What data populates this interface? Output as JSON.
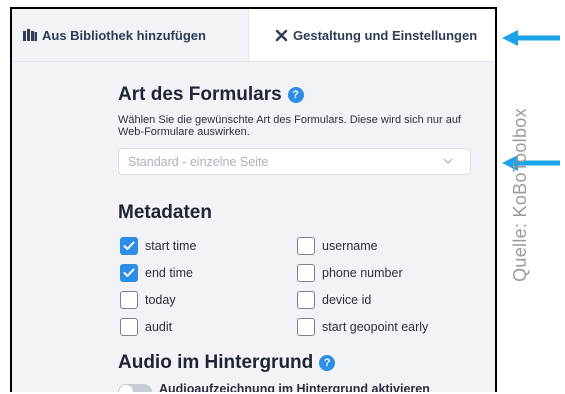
{
  "tabs": {
    "library": {
      "label": "Aus Bibliothek hinzufügen",
      "icon": "library-icon"
    },
    "design": {
      "label": "Gestaltung und Einstellungen",
      "icon": "close-x-icon"
    }
  },
  "form_type": {
    "title": "Art des Formulars",
    "help_icon": "help-icon",
    "description": "Wählen Sie die gewünschte Art des Formulars. Diese wird sich nur auf Web-Formulare auswirken.",
    "select_value": "Standard - einzelne Seite"
  },
  "metadata": {
    "title": "Metadaten",
    "left": [
      {
        "label": "start time",
        "checked": true
      },
      {
        "label": "end time",
        "checked": true
      },
      {
        "label": "today",
        "checked": false
      },
      {
        "label": "audit",
        "checked": false
      }
    ],
    "right": [
      {
        "label": "username",
        "checked": false
      },
      {
        "label": "phone number",
        "checked": false
      },
      {
        "label": "device id",
        "checked": false
      },
      {
        "label": "start geopoint early",
        "checked": false
      }
    ]
  },
  "background_audio": {
    "title": "Audio im Hintergrund",
    "toggle_label": "Audioaufzeichnung im Hintergrund aktivieren",
    "enabled": false
  },
  "annotation": {
    "source": "Quelle: KoBoToolbox",
    "arrow_color": "#1aa3e8"
  }
}
